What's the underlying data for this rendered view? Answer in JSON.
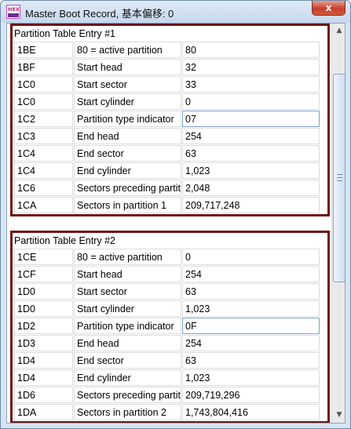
{
  "window": {
    "title": "Master Boot Record, 基本偏移: 0",
    "icon": "hex-editor-icon",
    "close_label": "x"
  },
  "scrollbar": {
    "up_arrow": "▲",
    "down_arrow": "▼",
    "position_fraction": 0.12,
    "visible_fraction": 0.55
  },
  "groups": [
    {
      "title": "Partition Table Entry #1",
      "rows": [
        {
          "offset": "1BE",
          "field": "80 = active partition",
          "value": "80"
        },
        {
          "offset": "1BF",
          "field": "Start head",
          "value": "32"
        },
        {
          "offset": "1C0",
          "field": "Start sector",
          "value": "33"
        },
        {
          "offset": "1C0",
          "field": "Start cylinder",
          "value": "0"
        },
        {
          "offset": "1C2",
          "field": "Partition type indicator",
          "value": "07"
        },
        {
          "offset": "1C3",
          "field": "End head",
          "value": "254"
        },
        {
          "offset": "1C4",
          "field": "End sector",
          "value": "63"
        },
        {
          "offset": "1C4",
          "field": "End cylinder",
          "value": "1,023"
        },
        {
          "offset": "1C6",
          "field": "Sectors preceding partition",
          "value": "2,048"
        },
        {
          "offset": "1CA",
          "field": "Sectors in partition 1",
          "value": "209,717,248"
        }
      ]
    },
    {
      "title": "Partition Table Entry #2",
      "rows": [
        {
          "offset": "1CE",
          "field": "80 = active partition",
          "value": "0"
        },
        {
          "offset": "1CF",
          "field": "Start head",
          "value": "254"
        },
        {
          "offset": "1D0",
          "field": "Start sector",
          "value": "63"
        },
        {
          "offset": "1D0",
          "field": "Start cylinder",
          "value": "1,023"
        },
        {
          "offset": "1D2",
          "field": "Partition type indicator",
          "value": "0F"
        },
        {
          "offset": "1D3",
          "field": "End head",
          "value": "254"
        },
        {
          "offset": "1D4",
          "field": "End sector",
          "value": "63"
        },
        {
          "offset": "1D4",
          "field": "End cylinder",
          "value": "1,023"
        },
        {
          "offset": "1D6",
          "field": "Sectors preceding partition",
          "value": "209,719,296"
        },
        {
          "offset": "1DA",
          "field": "Sectors in partition 2",
          "value": "1,743,804,416"
        }
      ]
    }
  ],
  "colors": {
    "group_border": "#6e1313",
    "titlebar": "#c6d8ee",
    "close_button": "#c6402b"
  }
}
